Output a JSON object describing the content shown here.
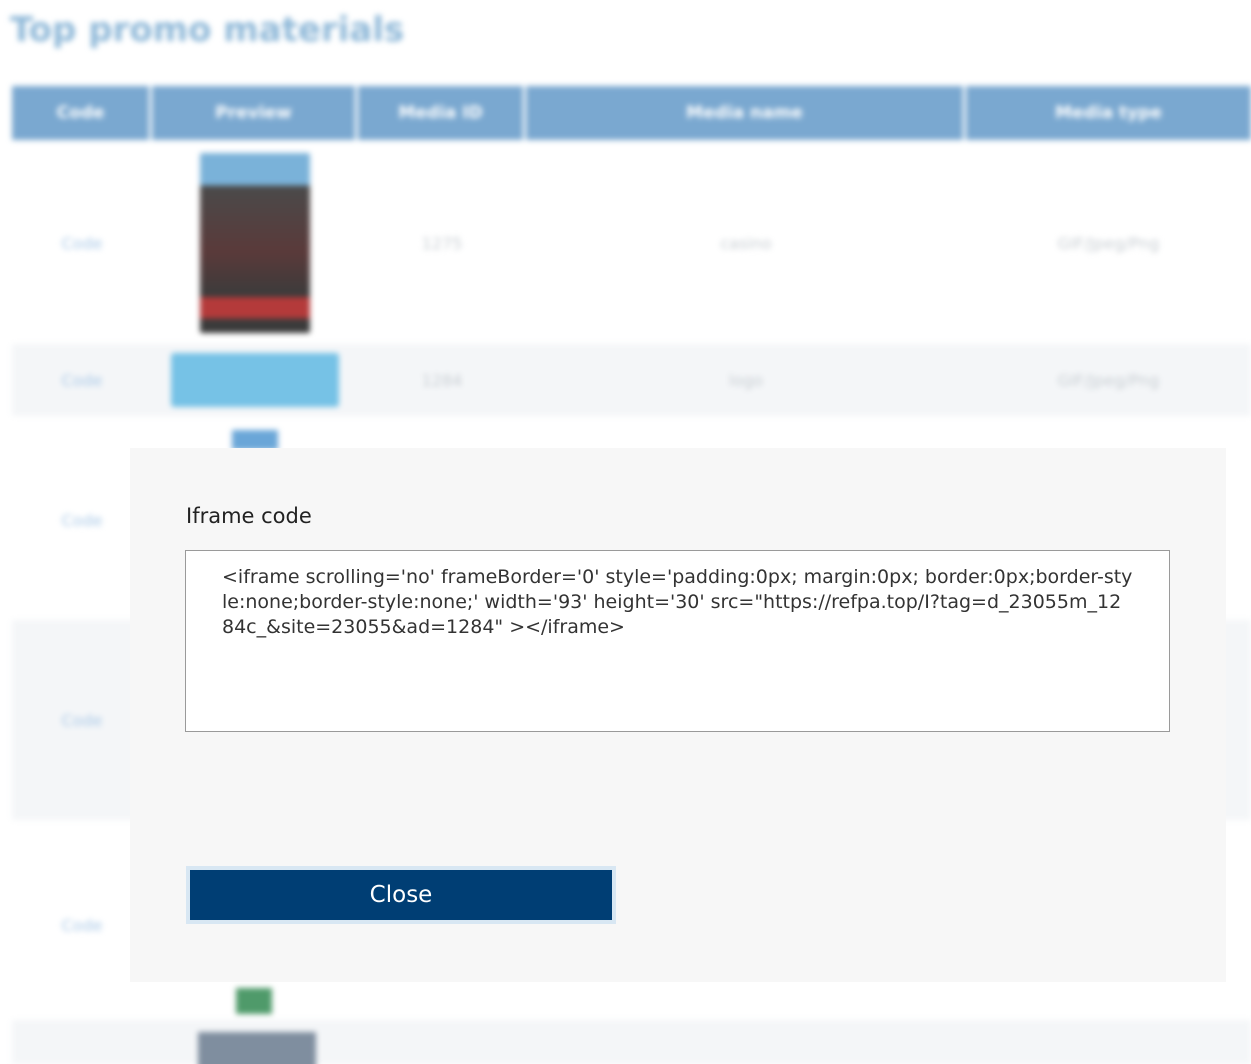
{
  "page": {
    "title": "Top promo materials"
  },
  "table": {
    "headers": [
      "Code",
      "Preview",
      "Media ID",
      "Media name",
      "Media type"
    ],
    "rows": [
      {
        "code": "Code",
        "media_id": "1275",
        "media_name": "casino",
        "media_type": "GIF/Jpeg/Png"
      },
      {
        "code": "Code",
        "media_id": "1284",
        "media_name": "logo",
        "media_type": "GIF/Jpeg/Png"
      },
      {
        "code": "Code"
      },
      {
        "code": "Code"
      },
      {
        "code": "Code"
      }
    ]
  },
  "modal": {
    "label": "Iframe code",
    "code_value": "<iframe scrolling='no' frameBorder='0' style='padding:0px; margin:0px; border:0px;border-style:none;border-style:none;' width='93' height='30' src=\"https://refpa.top/I?tag=d_23055m_1284c_&site=23055&ad=1284\" ></iframe>",
    "close_label": "Close"
  },
  "colors": {
    "header_bg": "#7aa8d0",
    "button_bg": "#003e74",
    "title_color": "#8eb8d8"
  }
}
